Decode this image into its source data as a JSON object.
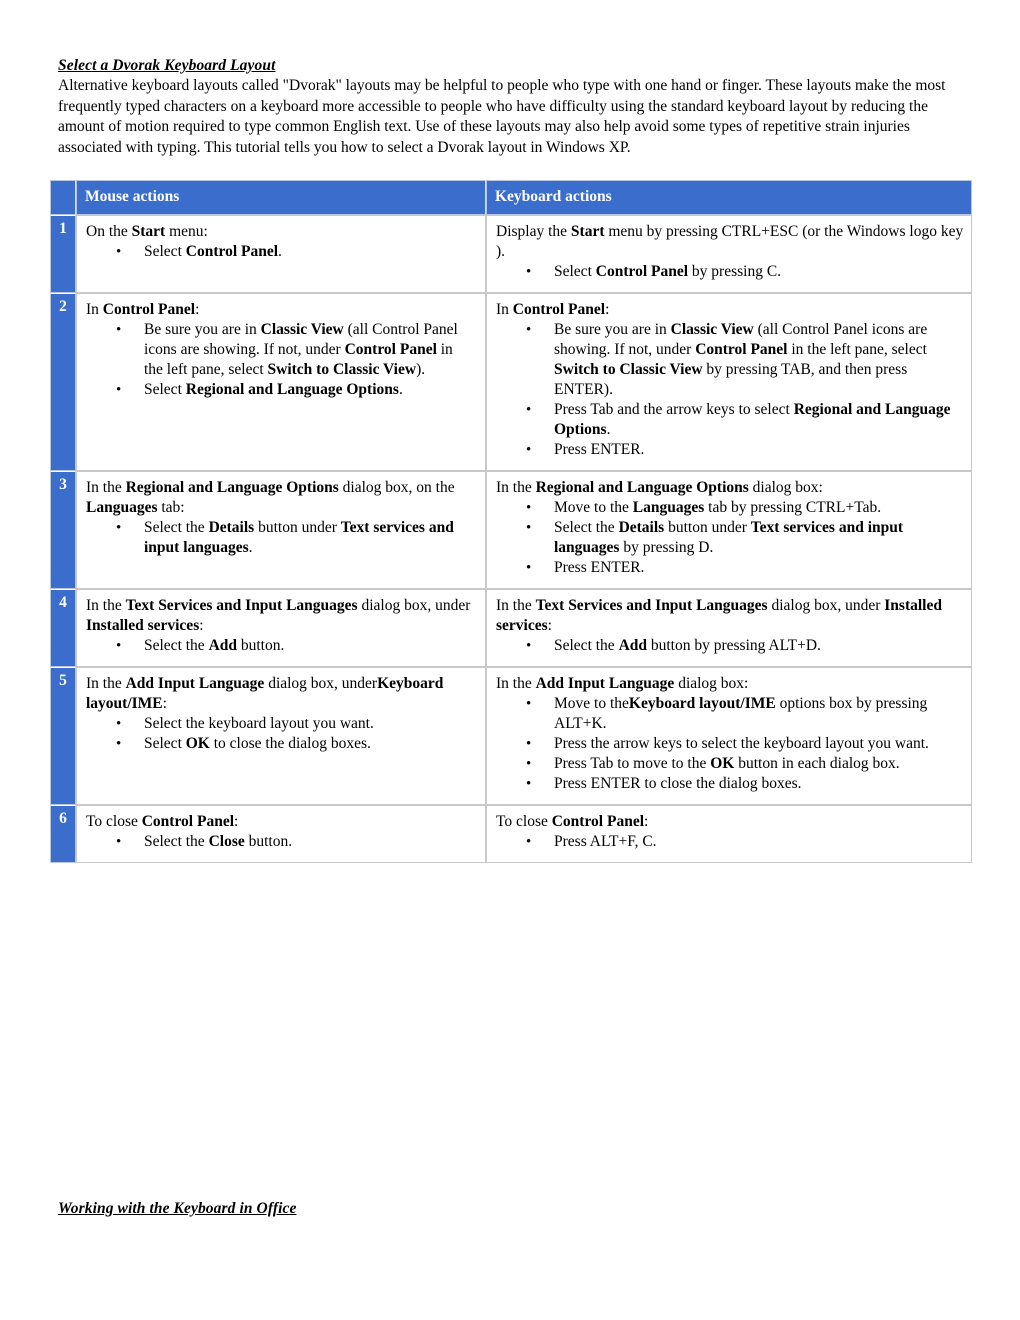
{
  "document": {
    "heading": "Select a Dvorak Keyboard Layout",
    "intro": "Alternative keyboard layouts called \"Dvorak\" layouts may be helpful to people who type with one hand or finger. These layouts make the most frequently typed characters on a keyboard more accessible to people who have difficulty using the standard keyboard layout by reducing the amount of motion required to type common English text. Use of these layouts may also help avoid some types of repetitive strain injuries associated with typing. This tutorial tells you how to select a Dvorak layout in Windows XP.",
    "bottom_heading": "Working with the Keyboard in Office",
    "header_color": "#3b6ecc",
    "bullet_glyph": "•"
  },
  "table": {
    "headers": {
      "number": "",
      "mouse": "Mouse actions",
      "keyboard": "Keyboard actions"
    },
    "rows": [
      {
        "number": "1",
        "mouse": {
          "lead_1": "On the ",
          "lead_b": "Start",
          "lead_2": " menu:",
          "bullets": [
            {
              "p1": "Select ",
              "b": "Control Panel",
              "p2": "."
            }
          ]
        },
        "keyboard": {
          "lead_1": "Display the ",
          "lead_b": "Start",
          "lead_2": " menu by pressing CTRL+ESC (or the Windows logo key     ).",
          "bullets": [
            {
              "p1": "Select ",
              "b": "Control Panel",
              "p2": " by pressing C."
            }
          ]
        }
      },
      {
        "number": "2",
        "mouse": {
          "lead_1": "In ",
          "lead_b": "Control Panel",
          "lead_2": ":",
          "bullets": [
            {
              "p1": "Be sure you are in ",
              "b": "Classic View",
              "p2": " (all Control Panel icons are showing. If not, under ",
              "b2": "Control Panel",
              "p3": " in the left pane, select ",
              "b3": "Switch to Classic View",
              "p4": ")."
            },
            {
              "p1": "Select ",
              "b": "Regional and Language Options",
              "p2": "."
            }
          ]
        },
        "keyboard": {
          "lead_1": "In ",
          "lead_b": "Control Panel",
          "lead_2": ":",
          "bullets": [
            {
              "p1": "Be sure you are in ",
              "b": "Classic View",
              "p2": " (all Control Panel icons are showing. If not, under ",
              "b2": "Control Panel",
              "p3": " in the left pane, select ",
              "b3": "Switch to Classic View",
              "p4": " by pressing TAB, and then press ENTER)."
            },
            {
              "p1": "Press Tab and the arrow keys to select ",
              "b": "Regional and Language Options",
              "p2": "."
            },
            {
              "p1": "Press ENTER.",
              "b": "",
              "p2": ""
            }
          ]
        }
      },
      {
        "number": "3",
        "mouse": {
          "lead_1": "In the ",
          "lead_b": "Regional and Language Options",
          "lead_2": " dialog box, on the ",
          "lead_b2": "Languages",
          "lead_3": " tab:",
          "bullets": [
            {
              "p1": "Select the ",
              "b": "Details",
              "p2": " button under ",
              "b2": "Text services and input languages",
              "p3": "."
            }
          ]
        },
        "keyboard": {
          "lead_1": "In the ",
          "lead_b": "Regional and Language Options",
          "lead_2": " dialog box:",
          "bullets": [
            {
              "p1": "Move to the ",
              "b": "Languages",
              "p2": " tab by pressing CTRL+Tab."
            },
            {
              "p1": "Select the ",
              "b": "Details",
              "p2": " button under ",
              "b2": "Text services and input languages",
              "p3": " by pressing D."
            },
            {
              "p1": "Press ENTER.",
              "b": "",
              "p2": ""
            }
          ]
        }
      },
      {
        "number": "4",
        "mouse": {
          "lead_1": "In the ",
          "lead_b": "Text Services and Input Languages",
          "lead_2": " dialog box, under ",
          "lead_b2": "Installed services",
          "lead_3": ":",
          "bullets": [
            {
              "p1": "Select the ",
              "b": "Add",
              "p2": " button."
            }
          ]
        },
        "keyboard": {
          "lead_1": "In the ",
          "lead_b": "Text Services and Input Languages",
          "lead_2": " dialog box, under ",
          "lead_b2": "Installed services",
          "lead_3": ":",
          "bullets": [
            {
              "p1": "Select the ",
              "b": "Add",
              "p2": " button by pressing ALT+D."
            }
          ]
        }
      },
      {
        "number": "5",
        "mouse": {
          "lead_1": "In the ",
          "lead_b": "Add Input Language",
          "lead_2": " dialog box, under",
          "lead_b2": "Keyboard layout/IME",
          "lead_3": ":",
          "bullets": [
            {
              "p1": "Select the keyboard layout you want.",
              "b": "",
              "p2": ""
            },
            {
              "p1": "Select ",
              "b": "OK",
              "p2": " to close the dialog boxes."
            }
          ]
        },
        "keyboard": {
          "lead_1": "In the ",
          "lead_b": "Add Input Language",
          "lead_2": " dialog box:",
          "bullets": [
            {
              "p1": "Move to the",
              "b": "Keyboard layout/IME",
              "p2": " options box by pressing ALT+K."
            },
            {
              "p1": "Press the arrow keys to select the keyboard layout you want.",
              "b": "",
              "p2": ""
            },
            {
              "p1": "Press Tab to move to the ",
              "b": "OK",
              "p2": " button in each dialog box."
            },
            {
              "p1": "Press ENTER to close the dialog boxes.",
              "b": "",
              "p2": ""
            }
          ]
        }
      },
      {
        "number": "6",
        "mouse": {
          "lead_1": "To close ",
          "lead_b": "Control Panel",
          "lead_2": ":",
          "bullets": [
            {
              "p1": "Select the ",
              "b": "Close",
              "p2": " button."
            }
          ]
        },
        "keyboard": {
          "lead_1": "To close ",
          "lead_b": "Control Panel",
          "lead_2": ":",
          "bullets": [
            {
              "p1": "Press ALT+F, C.",
              "b": "",
              "p2": ""
            }
          ]
        }
      }
    ]
  }
}
